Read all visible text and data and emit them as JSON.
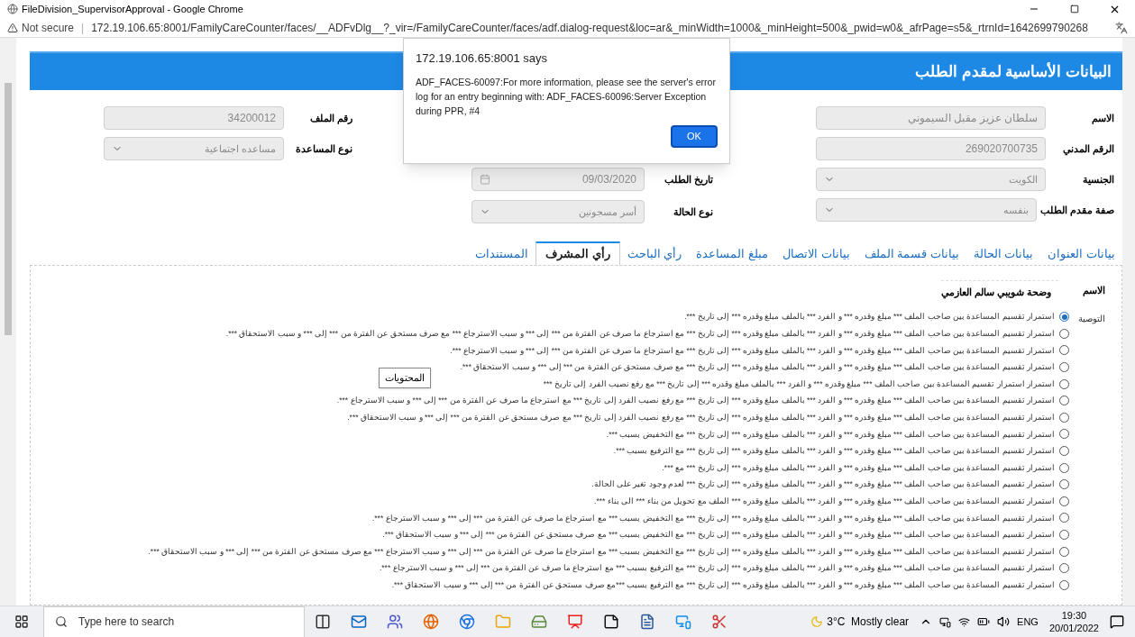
{
  "window": {
    "title": "FileDivision_SupervisorApproval - Google Chrome"
  },
  "address_bar": {
    "security": "Not secure",
    "separator": "|",
    "url": "172.19.106.65:8001/FamilyCareCounter/faces/__ADFvDlg__?_vir=/FamilyCareCounter/faces/adf.dialog-request&loc=ar&_minWidth=1000&_minHeight=500&_pwid=w0&_afrPage=s5&_rtrnId=1642699790268"
  },
  "header": {
    "title": "البيانات الأساسية لمقدم الطلب"
  },
  "form_columns": [
    {
      "fields": [
        {
          "label": "الاسم",
          "value": "سلطان عزيز مقبل السيموني",
          "kind": "input",
          "disabled": true
        },
        {
          "label": "الرقم المدني",
          "value": "269020700735",
          "kind": "input",
          "disabled": true
        },
        {
          "label": "الجنسية",
          "value": "الكويت",
          "kind": "select",
          "disabled": true
        },
        {
          "label": "صفة مقدم الطلب",
          "value": "بنفسه",
          "kind": "select",
          "disabled": true
        }
      ]
    },
    {
      "fields": [
        {
          "label": "تاريخ الطلب",
          "value": "09/03/2020",
          "kind": "date",
          "disabled": true
        },
        {
          "label": "نوع الحالة",
          "value": "أسر مسجونين",
          "kind": "select",
          "disabled": true
        }
      ]
    },
    {
      "fields": [
        {
          "label": "رقم الملف",
          "value": "34200012",
          "kind": "input",
          "disabled": true
        },
        {
          "label": "نوع المساعدة",
          "value": "مساعده اجتماعية",
          "kind": "select",
          "disabled": true
        }
      ]
    }
  ],
  "tabs": [
    {
      "label": "بيانات العنوان",
      "selected": false
    },
    {
      "label": "بيانات الحالة",
      "selected": false
    },
    {
      "label": "بيانات قسمة الملف",
      "selected": false
    },
    {
      "label": "بيانات الاتصال",
      "selected": false
    },
    {
      "label": "مبلغ المساعدة",
      "selected": false
    },
    {
      "label": "رأي الباحث",
      "selected": false
    },
    {
      "label": "رأي المشرف",
      "selected": true
    },
    {
      "label": "المستندات",
      "selected": false
    }
  ],
  "supervisor_panel": {
    "name_label": "الاسم",
    "name_value": "وضحة شويبي سالم العازمي",
    "recommendation_label": "التوصية",
    "options": [
      {
        "text": "استمرار تقسيم المساعدة بين صاحب الملف *** مبلغ وقدره *** و الفرد *** بالملف مبلغ وقدره *** إلى تاريخ ***.",
        "selected": true
      },
      {
        "text": "استمرار تقسيم المساعدة بين صاحب الملف *** مبلغ وقدره *** و الفرد *** بالملف مبلغ وقدره *** إلى تاريخ *** مع استرجاع ما صرف عن الفترة من *** إلى *** و سبب الاسترجاع *** مع صرف مستحق عن الفترة من *** إلى *** و سبب الاستحقاق ***.",
        "selected": false
      },
      {
        "text": "استمرار تقسيم المساعدة بين صاحب الملف *** مبلغ وقدره *** و الفرد *** بالملف مبلغ وقدره *** إلى تاريخ *** مع استرجاع ما صرف عن الفترة من *** إلى *** و سبب الاسترجاع ***.",
        "selected": false
      },
      {
        "text": "استمرار تقسيم المساعدة بين صاحب الملف *** مبلغ وقدره *** و الفرد *** بالملف مبلغ وقدره *** إلى تاريخ *** مع صرف مستحق عن الفترة من *** إلى *** و سبب الاستحقاق ***.",
        "selected": false
      },
      {
        "text": "استمرار استمرار تقسيم المساعدة بين صاحب الملف *** مبلغ وقدره *** و الفرد *** بالملف مبلغ وقدره *** إلى تاريخ *** مع رفع نصيب الفرد إلى تاريخ ***",
        "selected": false
      },
      {
        "text": "استمرار تقسيم المساعدة بين صاحب الملف *** مبلغ وقدره *** و الفرد *** بالملف مبلغ وقدره *** إلى تاريخ *** مع رفع نصيب الفرد إلى تاريخ *** مع استرجاع ما صرف عن الفترة من *** إلى *** و سبب الاسترجاع ***.",
        "selected": false
      },
      {
        "text": "استمرار تقسيم المساعدة بين صاحب الملف *** مبلغ وقدره *** و الفرد *** بالملف مبلغ وقدره *** إلى تاريخ *** مع رفع نصيب الفرد إلى تاريخ *** مع صرف مستحق عن الفترة من *** إلى *** و سبب الاستحقاق ***.",
        "selected": false
      },
      {
        "text": "استمرار تقسيم المساعدة بين صاحب الملف *** مبلغ وقدره *** و الفرد *** بالملف مبلغ وقدره *** إلى تاريخ *** مع التخفيض بسبب ***.",
        "selected": false
      },
      {
        "text": "استمرار تقسيم المساعدة بين صاحب الملف *** مبلغ وقدره *** و الفرد *** بالملف مبلغ وقدره *** إلى تاريخ *** مع الترفيع بسبب ***.",
        "selected": false
      },
      {
        "text": "استمرار تقسيم المساعدة بين صاحب الملف *** مبلغ وقدره *** و الفرد *** بالملف مبلغ وقدره *** إلى تاريخ *** مع ***.",
        "selected": false
      },
      {
        "text": "استمرار تقسيم المساعدة بين صاحب الملف *** مبلغ وقدره *** و الفرد *** بالملف مبلغ وقدره *** إلى تاريخ *** لعدم وجود تغير على الحالة.",
        "selected": false
      },
      {
        "text": "استمرار تقسيم المساعدة بين صاحب الملف *** مبلغ وقدره *** و الفرد *** بالملف مبلغ وقدره *** الملف مع تحويل من بناء *** الى بناء ***.",
        "selected": false
      },
      {
        "text": "استمرار تقسيم المساعدة بين صاحب الملف *** مبلغ وقدره *** و الفرد *** بالملف مبلغ وقدره *** إلى تاريخ *** مع التخفيض بسبب *** مع استرجاع ما صرف عن الفترة من *** إلى *** و سبب الاسترجاع ***.",
        "selected": false
      },
      {
        "text": "استمرار تقسيم المساعدة بين صاحب الملف *** مبلغ وقدره *** و الفرد *** بالملف مبلغ وقدره *** إلى تاريخ *** مع التخفيض بسبب *** مع صرف مستحق عن الفترة من *** إلى *** و سبب الاستحقاق ***.",
        "selected": false
      },
      {
        "text": "استمرار تقسيم المساعدة بين صاحب الملف *** مبلغ وقدره *** و الفرد *** بالملف مبلغ وقدره *** إلى تاريخ *** مع التخفيض بسبب *** مع استرجاع ما صرف عن الفترة من *** إلى *** و سبب الاسترجاع *** مع صرف مستحق عن الفترة من *** إلى *** و سبب الاستحقاق ***.",
        "selected": false
      },
      {
        "text": "استمرار تقسيم المساعدة بين صاحب الملف *** مبلغ وقدره *** و الفرد *** بالملف مبلغ وقدره *** إلى تاريخ *** مع الترفيع بسبب *** مع استرجاع ما صرف عن الفترة من *** إلى *** و سبب الاسترجاع ***.",
        "selected": false
      },
      {
        "text": "استمرار تقسيم المساعدة بين صاحب الملف *** مبلغ وقدره *** و الفرد *** بالملف مبلغ وقدره *** إلى تاريخ *** مع الترفيع بسبب ***مع صرف مستحق عن الفترة من *** إلى *** و سبب الاستحقاق ***.",
        "selected": false
      }
    ]
  },
  "tooltip": {
    "text": "المحتويات"
  },
  "dialog": {
    "title": "172.19.106.65:8001 says",
    "message": "ADF_FACES-60097:For more information, please see the server's error log for an entry beginning with: ADF_FACES-60096:Server Exception during PPR, #4",
    "button": "OK"
  },
  "taskbar": {
    "search_placeholder": "Type here to search",
    "weather": "3°C  Mostly clear",
    "language": "ENG",
    "time": "19:30",
    "date": "20/01/2022"
  }
}
